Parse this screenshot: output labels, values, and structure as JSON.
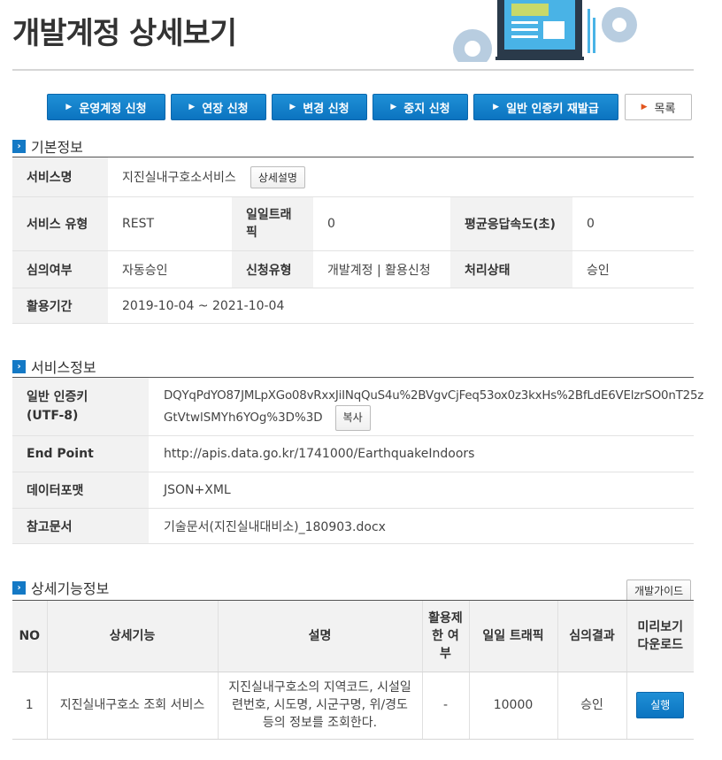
{
  "page": {
    "title": "개발계정 상세보기"
  },
  "actions": {
    "operating_account": "운영계정 신청",
    "extend": "연장 신청",
    "change": "변경 신청",
    "stop": "중지 신청",
    "reissue_key": "일반 인증키 재발급",
    "list": "목록"
  },
  "basic": {
    "section_title": "기본정보",
    "service_name_label": "서비스명",
    "service_name": "지진실내구호소서비스",
    "detail_button": "상세설명",
    "service_type_label": "서비스 유형",
    "service_type": "REST",
    "daily_traffic_label": "일일트래픽",
    "daily_traffic": "0",
    "avg_response_label": "평균응답속도(초)",
    "avg_response": "0",
    "review_label": "심의여부",
    "review": "자동승인",
    "apply_type_label": "신청유형",
    "apply_type": "개발계정 | 활용신청",
    "status_label": "처리상태",
    "status": "승인",
    "period_label": "활용기간",
    "period": "2019-10-04 ~ 2021-10-04"
  },
  "service": {
    "section_title": "서비스정보",
    "key_label_1": "일반 인증키",
    "key_label_2": "(UTF-8)",
    "key_line_1": "DQYqPdYO87JMLpXGo08vRxxJiINqQuS4u%2BVgvCjFeq53ox0z3kxHs%2BfLdE6VElzrSO0nT25z",
    "key_line_2": "GtVtwlSMYh6YOg%3D%3D",
    "copy_button": "복사",
    "endpoint_label": "End Point",
    "endpoint": "http://apis.data.go.kr/1741000/EarthquakeIndoors",
    "format_label": "데이터포맷",
    "format": "JSON+XML",
    "doc_label": "참고문서",
    "doc": "기술문서(지진실내대비소)_180903.docx"
  },
  "functions": {
    "section_title": "상세기능정보",
    "guide_button": "개발가이드",
    "headers": {
      "no": "NO",
      "name": "상세기능",
      "desc": "설명",
      "limit_1": "활용제",
      "limit_2": "한 여",
      "limit_3": "부",
      "traffic": "일일 트래픽",
      "result": "심의결과",
      "preview_1": "미리보기",
      "preview_2": "다운로드"
    },
    "rows": [
      {
        "no": "1",
        "name": "지진실내구호소 조회 서비스",
        "desc_1": "지진실내구호소의 지역코드, 시설일",
        "desc_2": "련번호, 시도명, 시군구명, 위/경도",
        "desc_3": "등의 정보를 조회한다.",
        "limit": "-",
        "traffic": "10000",
        "result": "승인",
        "run": "실행"
      }
    ]
  },
  "colors": {
    "accent": "#1479c5",
    "button_blue": "#0b74c0",
    "label_bg": "#f2f2f2"
  }
}
